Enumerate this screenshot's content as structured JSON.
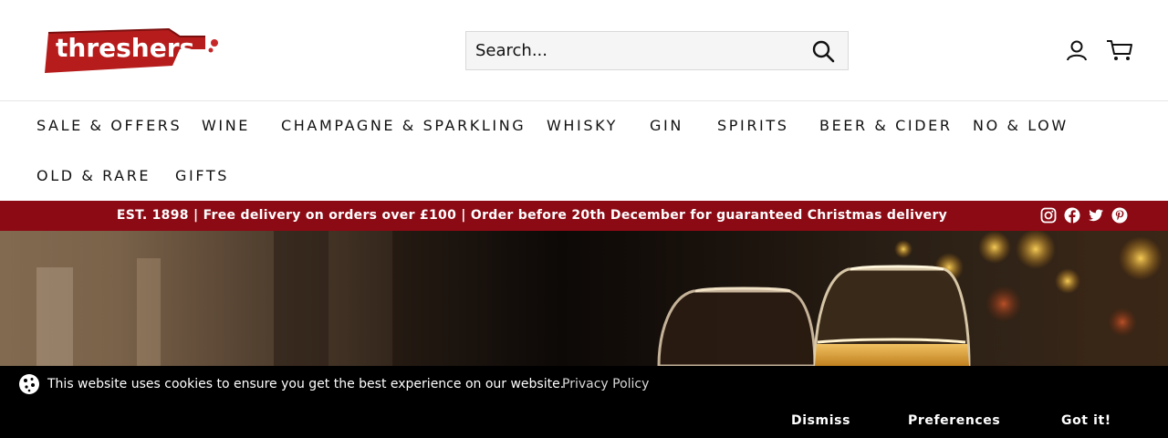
{
  "brand": {
    "logo_text": "threshers",
    "logo_color": "#b71c1c"
  },
  "search": {
    "placeholder": "Search...",
    "icon": "search-icon"
  },
  "header_icons": {
    "account": "account-icon",
    "cart": "cart-icon"
  },
  "nav": {
    "items": [
      {
        "label": "SALE & OFFERS"
      },
      {
        "label": "WINE"
      },
      {
        "label": "CHAMPAGNE & SPARKLING"
      },
      {
        "label": "WHISKY"
      },
      {
        "label": "GIN"
      },
      {
        "label": "SPIRITS"
      },
      {
        "label": "BEER & CIDER"
      },
      {
        "label": "NO & LOW"
      },
      {
        "label": "OLD & RARE"
      },
      {
        "label": "GIFTS"
      }
    ]
  },
  "announcement": {
    "text": "EST. 1898 | Free delivery on orders over £100 | Order before 20th December for guaranteed Christmas delivery",
    "background": "#8b0a14",
    "social": [
      "instagram-icon",
      "facebook-icon",
      "twitter-icon",
      "pinterest-icon"
    ]
  },
  "cookie_banner": {
    "message": "This website uses cookies to ensure you get the best experience on our website.",
    "link_label": "Privacy Policy",
    "dismiss_label": "Dismiss",
    "preferences_label": "Preferences",
    "accept_label": "Got it!"
  }
}
